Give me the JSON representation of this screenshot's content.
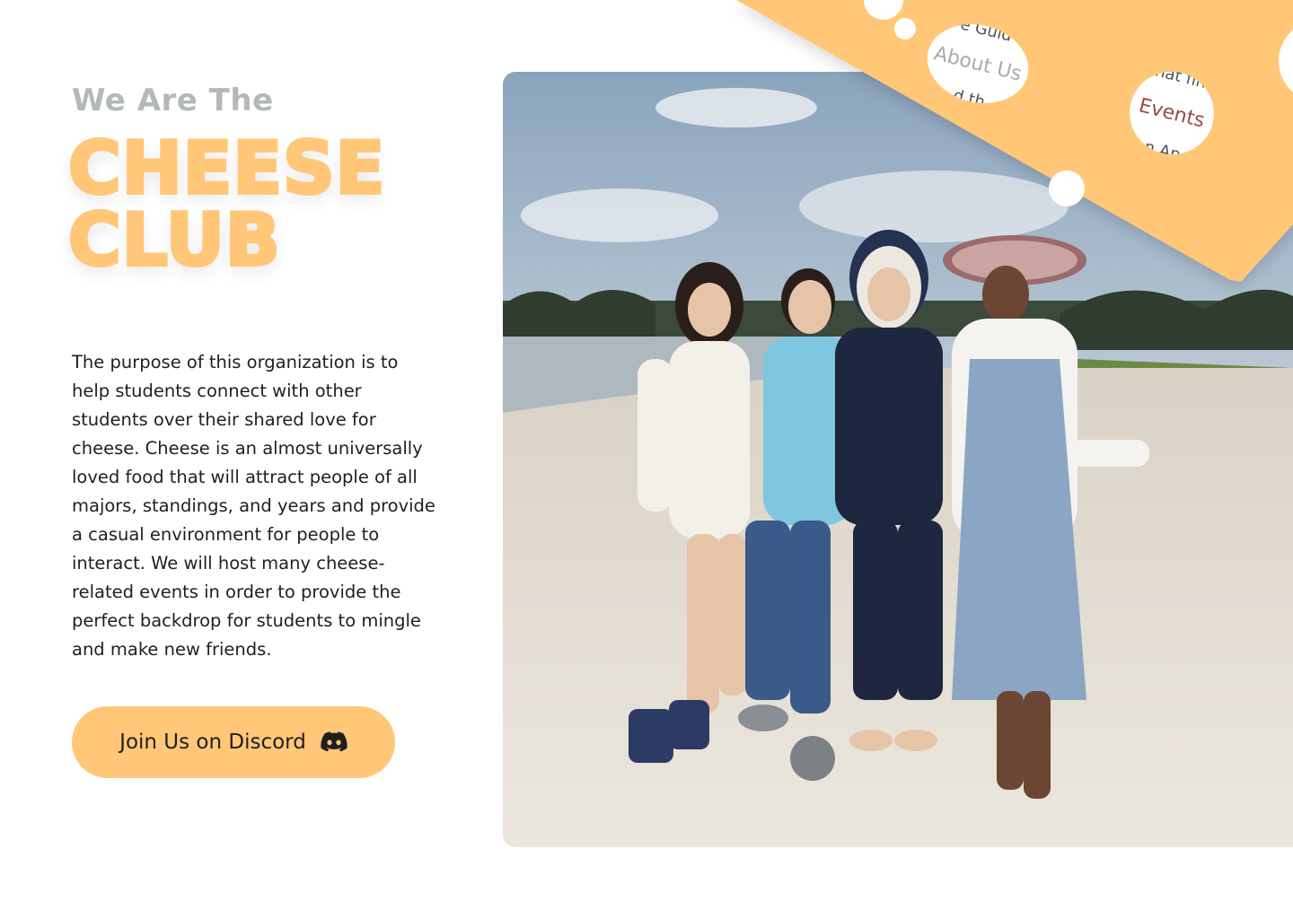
{
  "hero": {
    "kicker": "We Are The",
    "title_line1": "CHEESE",
    "title_line2": "CLUB",
    "description": "The purpose of this organization is to help students connect with other students over their shared love for cheese. Cheese is an almost universally loved food that will attract people of all majors, standings, and years and provide a casual environment for people to interact. We will host many cheese-related events in order to provide the perfect backdrop for students to mingle and make new friends.",
    "cta_label": "Join Us on Discord",
    "cta_icon": "discord-icon"
  },
  "nav": {
    "items": [
      {
        "label": "About Us"
      },
      {
        "label": "Events"
      }
    ]
  },
  "colors": {
    "accent": "#ffc777",
    "kicker": "#b3b8b9",
    "text": "#1f1f1f",
    "events_link": "#9a4a40"
  }
}
